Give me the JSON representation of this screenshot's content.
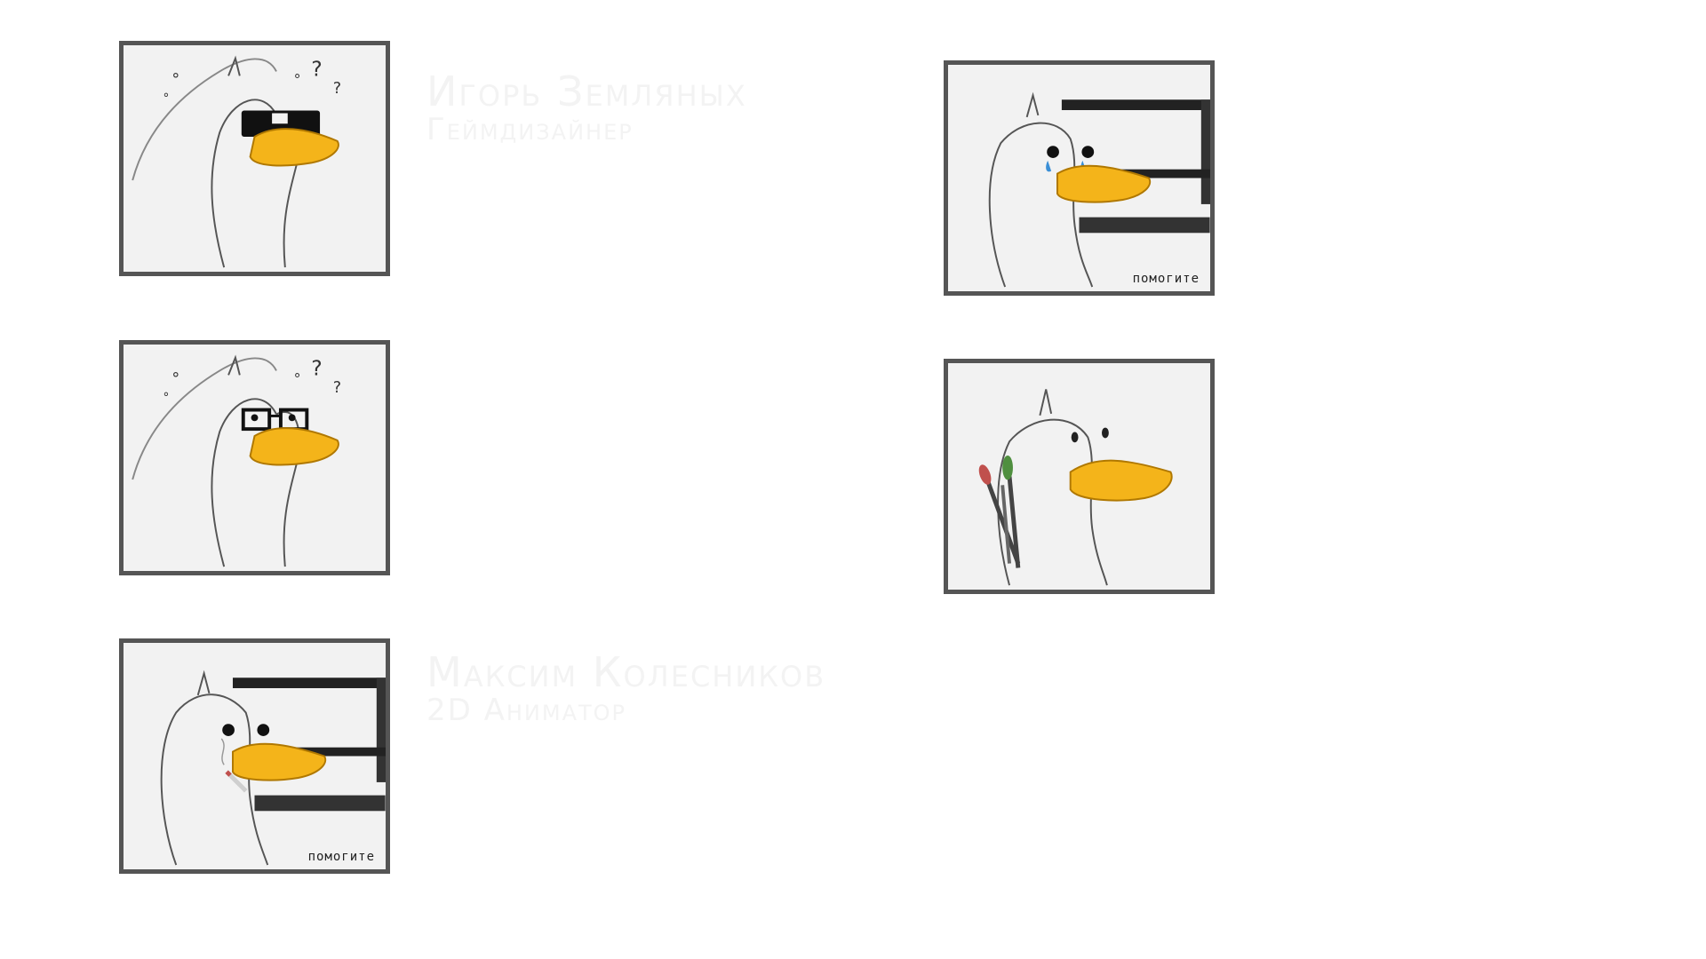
{
  "members": [
    {
      "name": "Игорь Земляных",
      "role": "Геймдизайнер",
      "avatar_icon": "duck-sunglasses-icon"
    },
    {
      "avatar_icon": "duck-glasses-icon"
    },
    {
      "name": "Максим Колесников",
      "role": "2D Аниматор",
      "avatar_icon": "duck-smoking-computer-icon",
      "caption": "помогите"
    },
    {
      "avatar_icon": "duck-crying-computer-icon",
      "caption": "помогите"
    },
    {
      "avatar_icon": "duck-paintbrushes-icon"
    }
  ],
  "colors": {
    "background": "#ffffff",
    "card_border": "#555555",
    "card_fill": "#f2f2f2",
    "beak": "#f4b41a",
    "text_faint": "#f3f3f3"
  }
}
